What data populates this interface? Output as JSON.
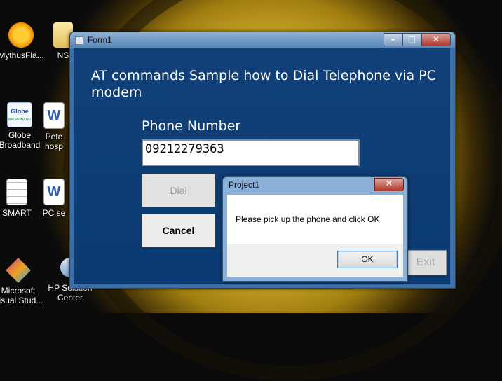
{
  "desktop": {
    "icons": [
      {
        "label": "MythusFla...",
        "icon": "sun-smiley-icon"
      },
      {
        "label": "NS",
        "icon": "folder-icon"
      },
      {
        "label": "Globe Broadband",
        "icon": "globe-broadband-icon",
        "badge": "Globe",
        "badge2": "BROADBAND"
      },
      {
        "label": "Pete hosp",
        "icon": "word-document-icon"
      },
      {
        "label": "SMART",
        "icon": "text-file-icon"
      },
      {
        "label": "PC se",
        "icon": "word-document-icon"
      },
      {
        "label": "Microsoft Visual Stud...",
        "icon": "visual-studio-icon"
      },
      {
        "label": "HP Solution Center",
        "icon": "hp-solution-center-icon"
      }
    ]
  },
  "form1": {
    "title": "Form1",
    "heading": "AT commands Sample how to Dial Telephone via PC modem",
    "phone_label": "Phone Number",
    "phone_value": "09212279363",
    "dial_label": "Dial",
    "cancel_label": "Cancel",
    "exit_label": "Exit",
    "caption": {
      "minimize": "–",
      "maximize": "□",
      "close": "✕"
    }
  },
  "msgbox": {
    "title": "Project1",
    "message": "Please pick up the phone and click OK",
    "ok_label": "OK",
    "close_glyph": "✕"
  }
}
